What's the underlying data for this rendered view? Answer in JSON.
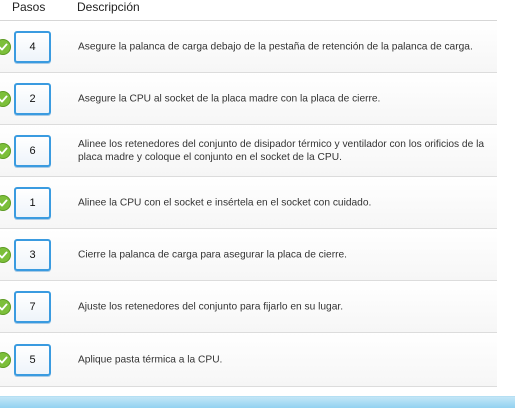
{
  "table": {
    "headers": {
      "steps": "Pasos",
      "description": "Descripción"
    },
    "rows": [
      {
        "number": "4",
        "description": "Asegure la palanca de carga debajo de la pestaña de retención de la palanca de carga."
      },
      {
        "number": "2",
        "description": "Asegure la CPU al socket de la placa madre con la placa de cierre."
      },
      {
        "number": "6",
        "description": "Alinee los retenedores del conjunto de disipador térmico y ventilador con los orificios de la placa madre y coloque el conjunto en el socket de la CPU."
      },
      {
        "number": "1",
        "description": "Alinee la CPU con el socket e insértela en el socket con cuidado."
      },
      {
        "number": "3",
        "description": "Cierre la palanca de carga para asegurar la placa de cierre."
      },
      {
        "number": "7",
        "description": "Ajuste los retenedores del conjunto para fijarlo en su lugar."
      },
      {
        "number": "5",
        "description": "Aplique pasta térmica a la CPU."
      }
    ]
  },
  "colors": {
    "accent_border": "#3a9be0",
    "check_green": "#7cbf3a",
    "bottom_band": "#8ed0f0"
  },
  "icons": {
    "row_status": "check-icon"
  }
}
